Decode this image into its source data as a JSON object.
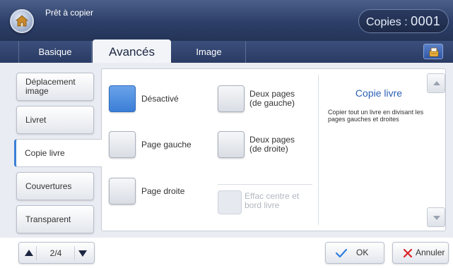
{
  "header": {
    "status": "Prêt à copier",
    "copies_label": "Copies :",
    "copies_value": "0001"
  },
  "tabs": [
    {
      "label": "Basique",
      "active": false
    },
    {
      "label": "Avancés",
      "active": true
    },
    {
      "label": "Image",
      "active": false
    }
  ],
  "header_icons": {
    "home": "home-icon",
    "job_status": "job-status-icon"
  },
  "sidebar": {
    "items": [
      {
        "label": "Déplacement image",
        "active": false
      },
      {
        "label": "Livret",
        "active": false
      },
      {
        "label": "Copie livre",
        "active": true
      },
      {
        "label": "Couvertures",
        "active": false
      },
      {
        "label": "Transparent",
        "active": false
      }
    ]
  },
  "options": [
    {
      "label": "Désactivé",
      "selected": true,
      "enabled": true
    },
    {
      "label": "Page gauche",
      "selected": false,
      "enabled": true
    },
    {
      "label": "Page droite",
      "selected": false,
      "enabled": true
    },
    {
      "label": "Deux pages (de gauche)",
      "selected": false,
      "enabled": true
    },
    {
      "label": "Deux pages (de droite)",
      "selected": false,
      "enabled": true
    },
    {
      "label": "Effac centre et bord livre",
      "selected": false,
      "enabled": false
    }
  ],
  "description": {
    "title": "Copie livre",
    "text": "Copier tout un livre en divisant les pages gauches et droites"
  },
  "pager": {
    "text": "2/4"
  },
  "actions": {
    "ok_label": "OK",
    "cancel_label": "Annuler"
  },
  "colors": {
    "accent": "#3b7fd6",
    "header_bg": "#2d3f68",
    "title_blue": "#2b5fb3",
    "cancel_red": "#d8232a",
    "ok_blue": "#2f7fe0"
  }
}
